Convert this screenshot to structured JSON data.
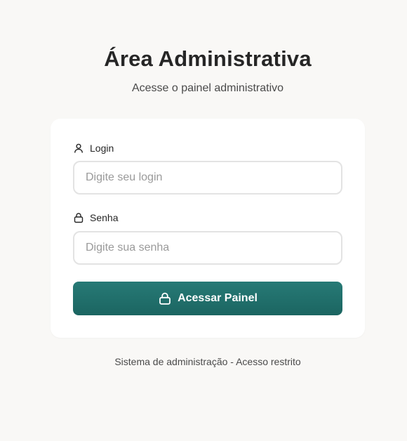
{
  "header": {
    "title": "Área Administrativa",
    "subtitle": "Acesse o painel administrativo"
  },
  "form": {
    "login": {
      "label": "Login",
      "icon": "user-icon",
      "value": "",
      "placeholder": "Digite seu login"
    },
    "password": {
      "label": "Senha",
      "icon": "lock-icon",
      "value": "",
      "placeholder": "Digite sua senha"
    },
    "submit": {
      "label": "Acessar Painel",
      "icon": "lock-icon"
    }
  },
  "footer": {
    "text": "Sistema de administração - Acesso restrito"
  },
  "colors": {
    "background": "#f9f8f6",
    "card": "#ffffff",
    "accent": "#1f6f6b",
    "input_border": "#e3e3e3",
    "text": "#262626",
    "muted_text": "#4a4a4a",
    "placeholder": "#9a9a9a"
  }
}
